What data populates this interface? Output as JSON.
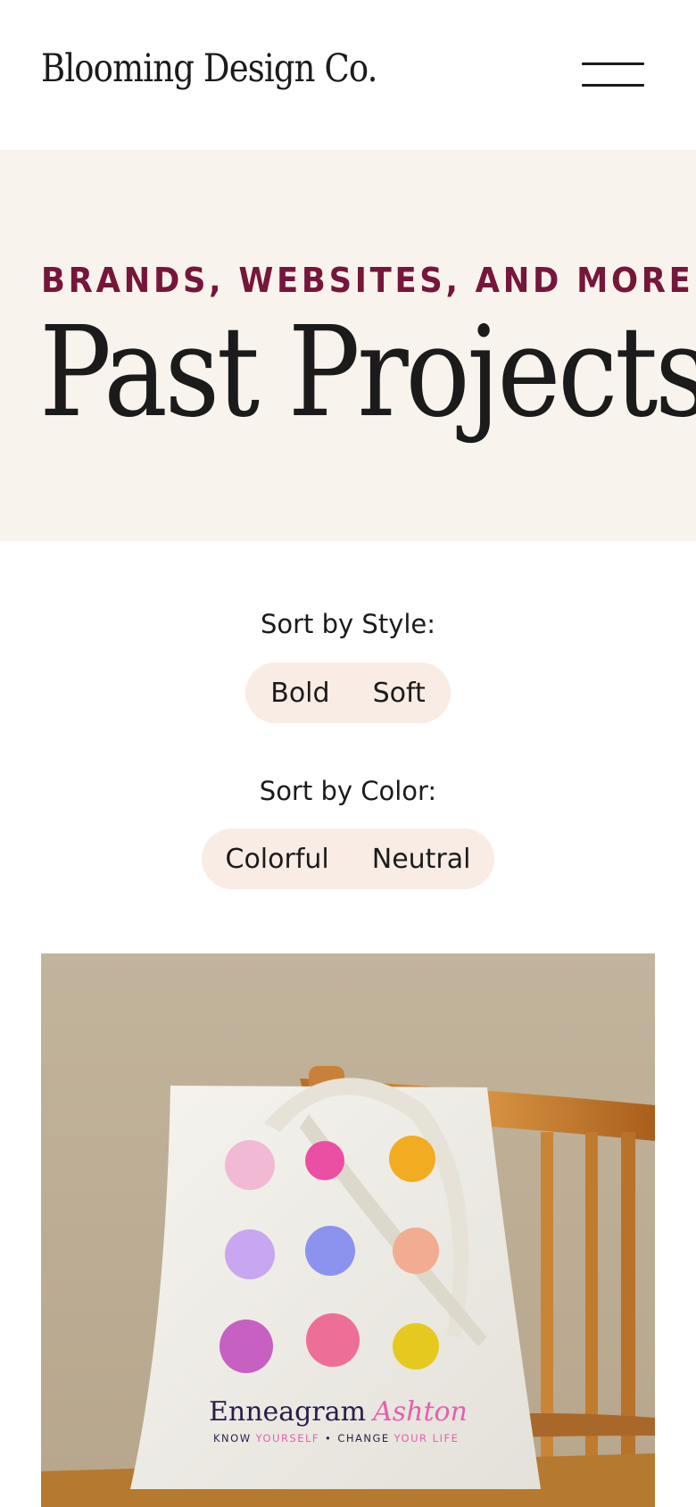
{
  "header": {
    "site_title": "Blooming Design Co.",
    "menu_icon": "hamburger-menu-icon"
  },
  "hero": {
    "eyebrow": "BRANDS, WEBSITES, AND MORE",
    "title": "Past Projects"
  },
  "filters": {
    "style": {
      "label": "Sort by Style:",
      "options": [
        "Bold",
        "Soft"
      ]
    },
    "color": {
      "label": "Sort by Color:",
      "options": [
        "Colorful",
        "Neutral"
      ]
    }
  },
  "projects": [
    {
      "image": "tote-bag-on-chair-photo",
      "bag_brand_part1": "Enneagram",
      "bag_brand_part2": "Ashton",
      "bag_tagline_part1": "KNOW",
      "bag_tagline_part2": "YOURSELF",
      "bag_tagline_part3": "•",
      "bag_tagline_part4": "CHANGE",
      "bag_tagline_part5": "YOUR LIFE"
    }
  ],
  "colors": {
    "accent": "#75163a",
    "hero_bg": "#f8f3ec",
    "pill_bg": "#f9ece5",
    "text": "#1b1b1b"
  }
}
